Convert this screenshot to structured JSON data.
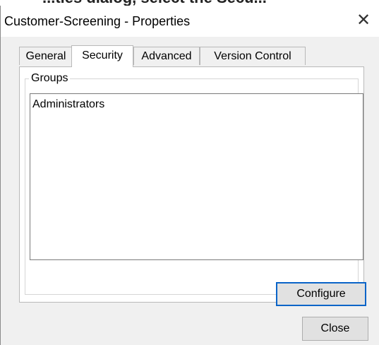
{
  "window": {
    "title": "Customer-Screening - Properties",
    "close_glyph": "✕",
    "close_icon": "close-icon"
  },
  "cropped_caption": "...ties dialog, select the Secu...",
  "tabs": [
    {
      "label": "General",
      "active": false
    },
    {
      "label": "Security",
      "active": true
    },
    {
      "label": "Advanced",
      "active": false
    },
    {
      "label": "Version Control",
      "active": false
    }
  ],
  "groups": {
    "legend": "Groups",
    "items": [
      "Administrators"
    ]
  },
  "buttons": {
    "configure": "Configure",
    "close": "Close"
  },
  "colors": {
    "dialog_bg": "#f0f0f0",
    "panel_bg": "#ffffff",
    "default_button_border": "#0a64c8",
    "button_bg": "#e1e1e1"
  }
}
